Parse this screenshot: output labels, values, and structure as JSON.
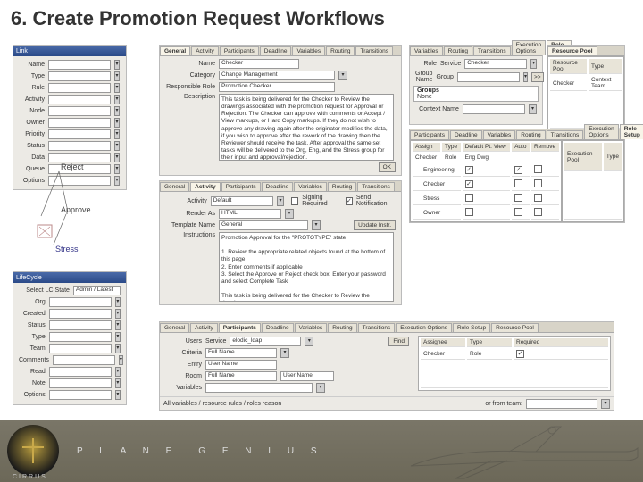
{
  "title": "6. Create Promotion Request Workflows",
  "left_panel": {
    "header": "Link",
    "rows": [
      "Name",
      "Type",
      "Rule",
      "Activity",
      "Node",
      "Owner",
      "Priority",
      "Status",
      "Data",
      "Queue",
      "Options"
    ],
    "value_suffix": ""
  },
  "workflow": {
    "reject": "Reject",
    "approve": "Approve",
    "stress": "Stress"
  },
  "general": {
    "tabs": [
      "General",
      "Activity",
      "Participants",
      "Deadline",
      "Variables",
      "Routing",
      "Transitions"
    ],
    "name_lbl": "Name",
    "name_val": "Checker",
    "cat_lbl": "Category",
    "cat_val": "Change Management",
    "resp_lbl": "Responsible Role",
    "resp_val": "Promotion Checker",
    "desc_lbl": "Description",
    "desc_val": "This task is being delivered for the Checker to Review the drawings associated with the promotion request for Approval or Rejection. The Checker can approve with comments or Accept / View markups, or Hard Copy markups. If they do not wish to approve any drawing again after the originator modifies the data, if you wish to approve after the rework of the drawing then the Reviewer should receive the task. After approval the same set tasks will be delivered to the Org, Eng, and the Stress group for their input and approval/rejection.",
    "ok": "OK"
  },
  "activity": {
    "tabs": [
      "General",
      "Activity",
      "Participants",
      "Deadline",
      "Variables",
      "Routing",
      "Transitions"
    ],
    "act_lbl": "Activity",
    "act_val": "Default",
    "render_lbl": "Render As",
    "render_val": "HTML",
    "tmpl_lbl": "Template Name",
    "tmpl_val": "General",
    "instr_lbl": "Instructions",
    "instr_val": "Promotion Approval for the \"PROTOTYPE\" state\n\n1. Review the appropriate related objects found at the bottom of this page\n2. Enter comments if applicable\n3. Select the Approve or Reject check box. Enter your password and select Complete Task\n\nThis task is being delivered for the Checker to Review the drawings",
    "sign_lbl": "Signing Required",
    "send_lbl": "Send Notification",
    "upd_btn": "Update Instr."
  },
  "participants": {
    "tabs": [
      "General",
      "Activity",
      "Participants",
      "Deadline",
      "Variables",
      "Routing",
      "Transitions",
      "Execution Options",
      "Role Setup",
      "Resource Pool"
    ],
    "users_lbl": "Users",
    "users_service": "Service",
    "users_val": "elodic_ldap",
    "find_btn": "Find",
    "criteria_lbl": "Criteria",
    "criteria_val": "Full Name",
    "entry_lbl": "Entry",
    "entry_val": "User Name",
    "room_lbl": "Room",
    "room_val": "Full Name",
    "room_val2": "User Name",
    "vars_lbl": "Variables",
    "asg_hdr1": "Assignee",
    "asg_hdr2": "Type",
    "asg_hdr3": "Required",
    "asg_row": "Checker",
    "asg_type": "Role",
    "footer_note": "All variables / resource rules / roles reason",
    "or_team": "or from team:"
  },
  "topright1": {
    "tabs": [
      "Variables",
      "Routing",
      "Transitions",
      "Execution Options",
      "Role Setup",
      "Resource Pool"
    ],
    "role_lbl": "Role",
    "role_val": "Service",
    "grp_lbl": "Group Name",
    "grp_val": "Group",
    "groups_hdr": "Groups",
    "groups_item": "None",
    "checker_val": "Checker",
    "context_name_lbl": "Context Name"
  },
  "topright2": {
    "hdr1": "Resource Pool",
    "hdr2": "Type",
    "row_name": "Checker",
    "row_type": "Context Team"
  },
  "checkgrid": {
    "tabs": [
      "Participants",
      "Deadline",
      "Variables",
      "Routing",
      "Transitions",
      "Execution Options",
      "Role Setup"
    ],
    "cols": [
      "Assign",
      "Type",
      "Default Pt. View",
      "Auto",
      "Remove"
    ],
    "rows": [
      {
        "name": "Checker",
        "role": "Role",
        "c": "Eng Dwg"
      },
      {
        "name": "Engineering"
      },
      {
        "name": "Checker"
      },
      {
        "name": "Stress"
      },
      {
        "name": "Owner"
      }
    ],
    "extra_cols": [
      "Execution Pool",
      "Type"
    ]
  },
  "bottom_left": {
    "header": "LifeCycle",
    "state_lbl": "Select LC State",
    "state_val": "Admin / Latest",
    "rows": [
      "Org",
      "Created",
      "Status",
      "Type",
      "Team",
      "Comments",
      "Read",
      "Note",
      "Options"
    ]
  },
  "footer": {
    "brandA": "P L A N E",
    "brandB": "G E N I U S",
    "sub": "CIRRUS"
  }
}
